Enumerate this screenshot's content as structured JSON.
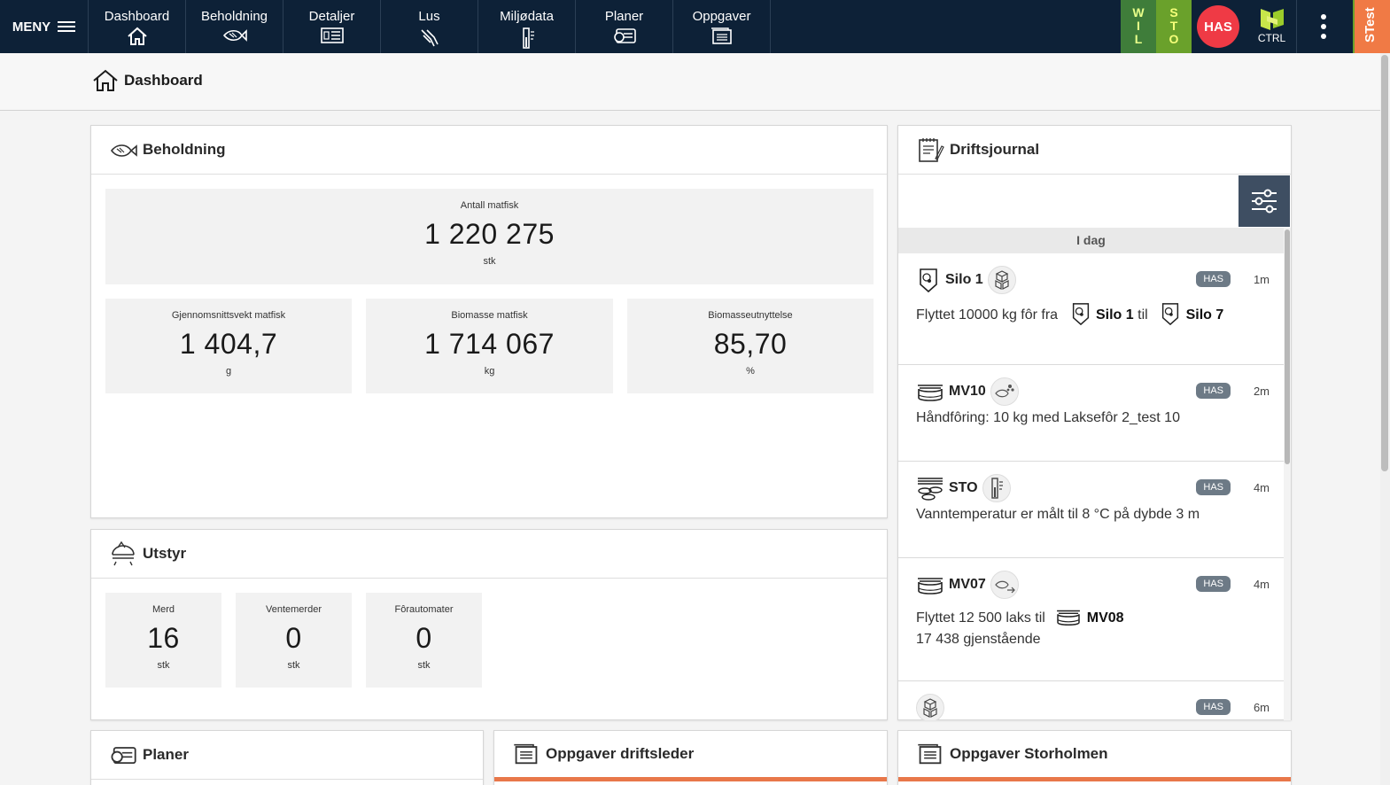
{
  "nav": {
    "menu_label": "MENY",
    "items": [
      {
        "label": "Dashboard",
        "icon": "home-icon"
      },
      {
        "label": "Beholdning",
        "icon": "fish-icon"
      },
      {
        "label": "Detaljer",
        "icon": "details-card-icon"
      },
      {
        "label": "Lus",
        "icon": "lice-icon"
      },
      {
        "label": "Miljødata",
        "icon": "thermometer-icon"
      },
      {
        "label": "Planer",
        "icon": "plans-icon"
      },
      {
        "label": "Oppgaver",
        "icon": "tasks-icon"
      }
    ],
    "site_tags": {
      "wil": [
        "W",
        "I",
        "L"
      ],
      "sto": [
        "S",
        "T",
        "O"
      ]
    },
    "user_initials": "HAS",
    "ctrl_label": "CTRL",
    "env_label": "STest"
  },
  "breadcrumb": {
    "label": "Dashboard"
  },
  "beholdning": {
    "title": "Beholdning",
    "antall": {
      "label": "Antall matfisk",
      "value": "1 220 275",
      "unit": "stk"
    },
    "vekt": {
      "label": "Gjennomsnittsvekt matfisk",
      "value": "1 404,7",
      "unit": "g"
    },
    "biomasse": {
      "label": "Biomasse matfisk",
      "value": "1 714 067",
      "unit": "kg"
    },
    "utnyttelse": {
      "label": "Biomasseutnyttelse",
      "value": "85,70",
      "unit": "%"
    }
  },
  "utstyr": {
    "title": "Utstyr",
    "merd": {
      "label": "Merd",
      "value": "16",
      "unit": "stk"
    },
    "ventemerder": {
      "label": "Ventemerder",
      "value": "0",
      "unit": "stk"
    },
    "forautomater": {
      "label": "Fôrautomater",
      "value": "0",
      "unit": "stk"
    }
  },
  "journal": {
    "title": "Driftsjournal",
    "day_label": "I dag",
    "entries": [
      {
        "unit": "Silo 1",
        "user": "HAS",
        "time": "1m",
        "text_a": "Flyttet 10000 kg fôr fra",
        "from": "Silo 1",
        "mid": "til",
        "to": "Silo 7"
      },
      {
        "unit": "MV10",
        "user": "HAS",
        "time": "2m",
        "text": "Håndfôring: 10 kg med Laksefôr 2_test 10"
      },
      {
        "unit": "STO",
        "user": "HAS",
        "time": "4m",
        "text": "Vanntemperatur er målt til 8 °C på dybde 3 m"
      },
      {
        "unit": "MV07",
        "user": "HAS",
        "time": "4m",
        "text_a": "Flyttet 12 500 laks til",
        "to": "MV08",
        "text_b": "17 438 gjenstående"
      },
      {
        "user": "HAS",
        "time": "6m"
      }
    ]
  },
  "bottom": {
    "planer": "Planer",
    "oppgaver_driftsleder": "Oppgaver driftsleder",
    "oppgaver_storholmen": "Oppgaver Storholmen"
  },
  "colors": {
    "navbar": "#0d2137",
    "wil": "#3f7d3a",
    "sto": "#6aa12b",
    "user": "#ef3a45",
    "env": "#f07a45",
    "accent_line": "#e8774a"
  }
}
